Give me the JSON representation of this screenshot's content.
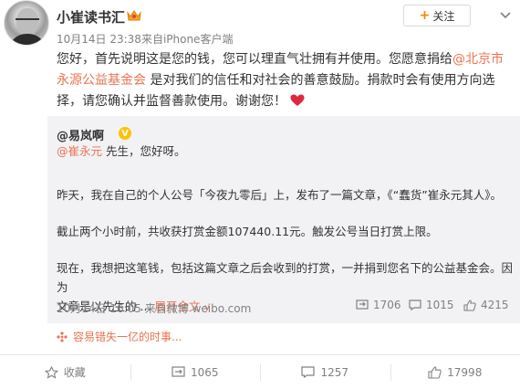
{
  "post": {
    "username": "小崔读书汇",
    "date": "10月14日 23:38",
    "source": "来自iPhone客户端",
    "follow_label": "关注",
    "text": {
      "part1": "您好，首先说明这是您的钱，您可以理直气壮拥有并使用。您愿意捐给",
      "link": "@北京市永源公益基金会",
      "part2": "是对我们的信任和对社会的善意鼓励。捐款时会有使用方向选择，请您确认并监督善款使用。谢谢您！"
    }
  },
  "repost": {
    "author": "@易岚啊",
    "mention": "@崔永元",
    "greeting": " 先生，您好呀。",
    "para1": "昨天，我在自己的个人公号「今夜九零后」上，发布了一篇文章，《“蠢货”崔永元其人》。",
    "para2": "截止两个小时前，共收获打赏金额107440.11元。触发公号当日打赏上限。",
    "para3_line1": "现在，我想把这笔钱，包括这篇文章之后会收到的打赏，一并捐到您名下的公益基金会。因为",
    "para3_line2": "文章是以先生的 ...",
    "expand_label": "展开全文",
    "expand_arrow": "∨",
    "date": "10月14日 16:05",
    "source": "来自微博 weibo.com",
    "reposts": "1706",
    "comments": "1015",
    "likes": "4215"
  },
  "promo": {
    "text": "容易错失一亿的时事..."
  },
  "actions": {
    "favorite": "收藏",
    "repost": "1065",
    "comment": "1257",
    "like": "17998"
  },
  "colors": {
    "link": "#eb7350",
    "accent": "#ff8200",
    "meta": "#808080",
    "repost_bg": "#f2f2f5"
  }
}
